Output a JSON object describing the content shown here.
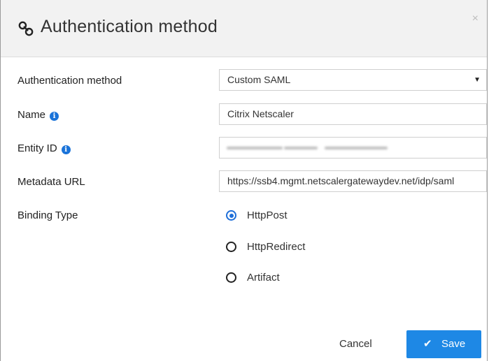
{
  "dialog": {
    "title": "Authentication method",
    "close_label": "×"
  },
  "form": {
    "auth_method": {
      "label": "Authentication method",
      "value": "Custom SAML"
    },
    "name": {
      "label": "Name",
      "value": "Citrix Netscaler"
    },
    "entity_id": {
      "label": "Entity ID",
      "value": ""
    },
    "metadata_url": {
      "label": "Metadata URL",
      "value": "https://ssb4.mgmt.netscalergatewaydev.net/idp/saml"
    },
    "binding": {
      "label": "Binding Type",
      "options": [
        "HttpPost",
        "HttpRedirect",
        "Artifact"
      ],
      "selected": "HttpPost"
    }
  },
  "footer": {
    "cancel_label": "Cancel",
    "save_label": "Save"
  },
  "colors": {
    "accent": "#1e88e5",
    "info_icon": "#1a73d9",
    "header_bg": "#f2f2f2"
  },
  "icons": [
    "link-icon",
    "close-icon",
    "info-icon",
    "chevron-down-icon",
    "check-icon"
  ]
}
